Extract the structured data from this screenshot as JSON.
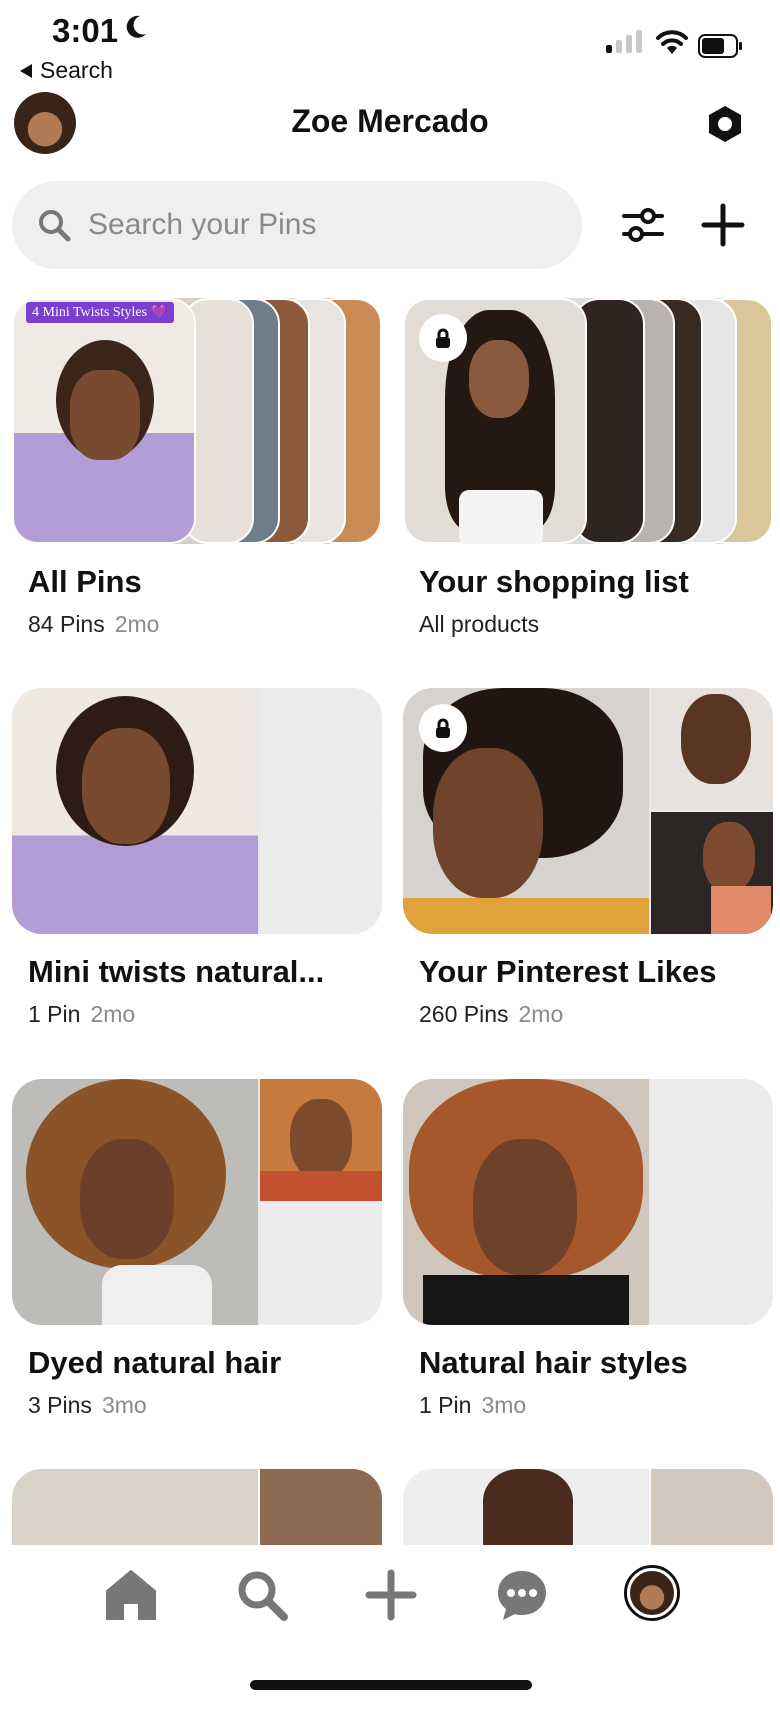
{
  "status_bar": {
    "time": "3:01",
    "back_label": "Search"
  },
  "header": {
    "title": "Zoe Mercado"
  },
  "search": {
    "placeholder": "Search your Pins",
    "value": ""
  },
  "boards": [
    {
      "name": "All Pins",
      "count": "84 Pins",
      "age": "2mo",
      "badge": "4 Mini Twists Styles 💜",
      "locked": false
    },
    {
      "name": "Your shopping list",
      "count": "All products",
      "age": "",
      "locked": true
    },
    {
      "name": "Mini twists natural...",
      "count": "1 Pin",
      "age": "2mo",
      "locked": false
    },
    {
      "name": "Your Pinterest Likes",
      "count": "260 Pins",
      "age": "2mo",
      "locked": true
    },
    {
      "name": "Dyed natural hair",
      "count": "3 Pins",
      "age": "3mo",
      "locked": false
    },
    {
      "name": "Natural hair styles",
      "count": "1 Pin",
      "age": "3mo",
      "locked": false
    }
  ],
  "nav": {
    "items": [
      "home-icon",
      "search-icon",
      "create-icon",
      "messages-icon",
      "profile-icon"
    ]
  },
  "colors": {
    "accent": "#111111",
    "search_bg": "#efefef",
    "muted": "#8a8a8a",
    "placeholder_tile": "#e9e9e9"
  }
}
